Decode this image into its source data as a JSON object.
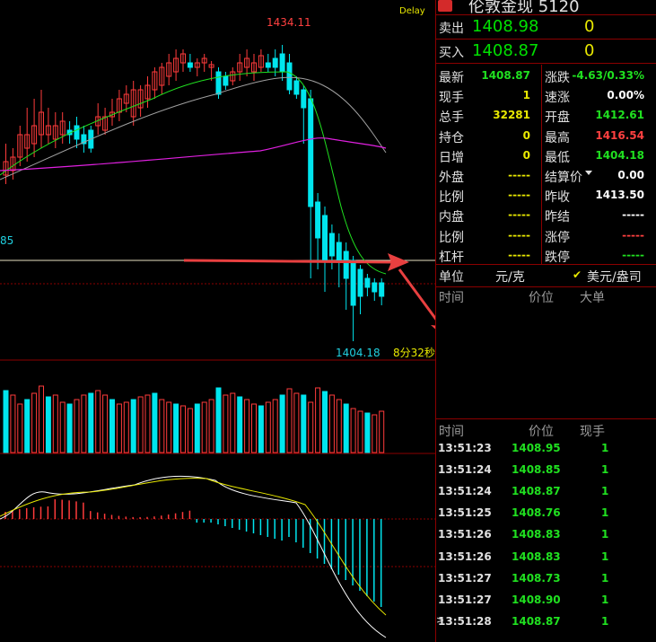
{
  "colors": {
    "up": "#ff3b3b",
    "down": "#00e5ee",
    "ma_short": "#20e020",
    "ma_mid": "#a0a0a0",
    "ma_long": "#e020e0",
    "grid": "#8b0000",
    "macd": "#ffffff",
    "signal": "#e8e800"
  },
  "chart": {
    "delay_label": "Delay",
    "high_label": "1434.11",
    "low_label": "1404.18",
    "left_price_label": "85",
    "countdown": "8分32秒"
  },
  "instrument": {
    "title": "伦敦金现  5120"
  },
  "quote": {
    "sell_label": "卖出",
    "sell_price": "1408.98",
    "sell_vol": "0",
    "buy_label": "买入",
    "buy_price": "1408.87",
    "buy_vol": "0"
  },
  "stats": [
    {
      "k": "最新",
      "v": "1408.87",
      "c": "green",
      "k2": "涨跌",
      "v2": "-4.63/0.33%",
      "c2": "green"
    },
    {
      "k": "现手",
      "v": "1",
      "c": "yellow",
      "k2": "速涨",
      "v2": "0.00%",
      "c2": "white"
    },
    {
      "k": "总手",
      "v": "32281",
      "c": "yellow",
      "k2": "开盘",
      "v2": "1412.61",
      "c2": "green"
    },
    {
      "k": "持仓",
      "v": "0",
      "c": "yellow",
      "k2": "最高",
      "v2": "1416.54",
      "c2": "red"
    },
    {
      "k": "日增",
      "v": "0",
      "c": "yellow",
      "k2": "最低",
      "v2": "1404.18",
      "c2": "green"
    },
    {
      "k": "外盘",
      "v": "-----",
      "c": "yellow",
      "k2": "结算价",
      "v2": "0.00",
      "c2": "white"
    },
    {
      "k": "比例",
      "v": "-----",
      "c": "yellow",
      "k2": "昨收",
      "v2": "1413.50",
      "c2": "white"
    },
    {
      "k": "内盘",
      "v": "-----",
      "c": "yellow",
      "k2": "昨结",
      "v2": "-----",
      "c2": "white"
    },
    {
      "k": "比例",
      "v": "-----",
      "c": "yellow",
      "k2": "涨停",
      "v2": "-----",
      "c2": "red"
    },
    {
      "k": "杠杆",
      "v": "-----",
      "c": "yellow",
      "k2": "跌停",
      "v2": "-----",
      "c2": "green"
    }
  ],
  "unit": {
    "label": "单位",
    "cny": "元/克",
    "usd": "美元/盎司",
    "check": "✔"
  },
  "large_orders": {
    "time": "时间",
    "price": "价位",
    "big": "大单"
  },
  "ticks_header": {
    "time": "时间",
    "price": "价位",
    "qty": "现手"
  },
  "ticks": [
    {
      "t": "13:51:23",
      "p": "1408.95",
      "q": "1"
    },
    {
      "t": "13:51:24",
      "p": "1408.85",
      "q": "1"
    },
    {
      "t": "13:51:24",
      "p": "1408.87",
      "q": "1"
    },
    {
      "t": "13:51:25",
      "p": "1408.76",
      "q": "1"
    },
    {
      "t": "13:51:26",
      "p": "1408.83",
      "q": "1"
    },
    {
      "t": "13:51:26",
      "p": "1408.83",
      "q": "1"
    },
    {
      "t": "13:51:27",
      "p": "1408.73",
      "q": "1"
    },
    {
      "t": "13:51:27",
      "p": "1408.90",
      "q": "1"
    },
    {
      "t": "13:51:28",
      "p": "1408.87",
      "q": "1"
    }
  ]
}
